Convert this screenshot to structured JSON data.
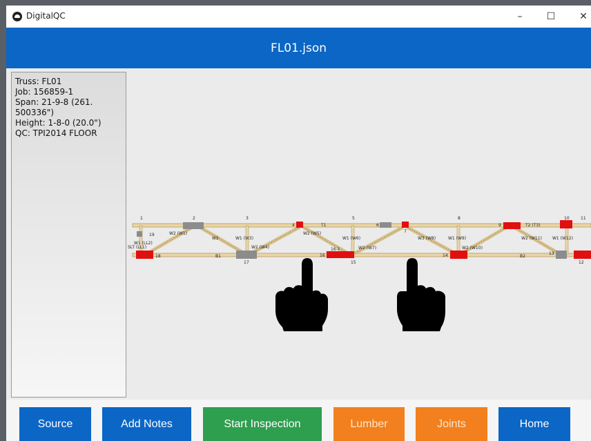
{
  "window": {
    "app_title": "DigitalQC",
    "minimize": "–",
    "maximize": "☐",
    "close": "✕"
  },
  "header": {
    "title": "FL01.json"
  },
  "info": {
    "truss": "Truss: FL01",
    "job": "Job: 156859-1",
    "span": "Span: 21-9-8 (261.\n500336\")",
    "height": "Height: 1-8-0 (20.0\")",
    "qc": "QC: TPI2014 FLOOR"
  },
  "truss": {
    "top_chord_label": "T1",
    "top_chord2_label": "T2 (T3)",
    "bottom_chord_label": "B1",
    "bottom_chord2_label": "B2",
    "joints_top": [
      "1",
      "2",
      "3",
      "4",
      "5",
      "6",
      "7",
      "8",
      "9",
      "10",
      "11"
    ],
    "joints_bottom": [
      "18",
      "17",
      "16",
      "15",
      "14",
      "13",
      "12"
    ],
    "web_labels": [
      "W2 (W1)",
      "W2",
      "W1 (W3)",
      "W2 (W4)",
      "W2 (W5)",
      "W1 (W6)",
      "W2 (W7)",
      "W3 (W8)",
      "W1 (W9)",
      "W2 (W10)",
      "W2 (W11)",
      "W1 (W12)"
    ],
    "side_labels": [
      "19",
      "W1 (LL2)",
      "SLT (LL1)",
      "16-1"
    ],
    "colors": {
      "lumber": "#e8d6a8",
      "lumber_edge": "#b59a60",
      "red_plate": "#e01010",
      "gray_plate": "#8c8c8c"
    }
  },
  "footer": {
    "source": "Source",
    "add_notes": "Add Notes",
    "start_inspection": "Start Inspection",
    "lumber": "Lumber",
    "joints": "Joints",
    "home": "Home"
  },
  "icons": [
    "app-logo-icon",
    "minimize-icon",
    "maximize-icon",
    "close-icon",
    "pointing-hand-icon"
  ]
}
